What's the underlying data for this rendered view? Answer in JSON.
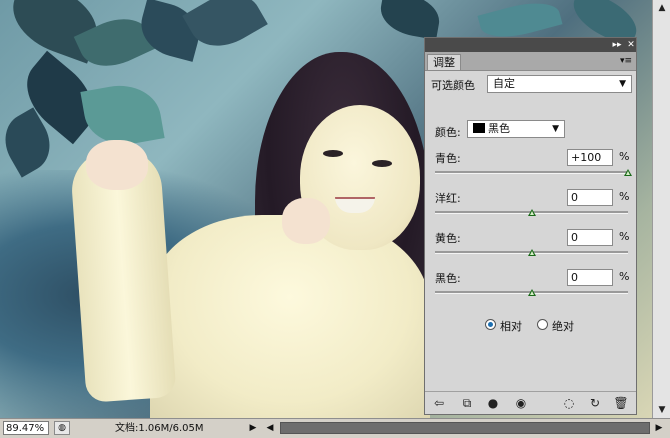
{
  "panel": {
    "tab_label": "调整",
    "collapse_icon": "double-chevron-right-icon",
    "close_icon": "close-icon",
    "menu_icon": "panel-menu-icon",
    "title_label": "可选颜色",
    "preset_value": "自定",
    "colors_label": "颜色:",
    "colors_value": "黑色",
    "sliders": [
      {
        "label": "青色:",
        "value": "+100",
        "unit": "%",
        "position": 1.0
      },
      {
        "label": "洋红:",
        "value": "0",
        "unit": "%",
        "position": 0.5
      },
      {
        "label": "黄色:",
        "value": "0",
        "unit": "%",
        "position": 0.5
      },
      {
        "label": "黑色:",
        "value": "0",
        "unit": "%",
        "position": 0.5
      }
    ],
    "method": {
      "relative_label": "相对",
      "absolute_label": "绝对",
      "selected": "relative"
    },
    "toolbar_icons": [
      "back-arrow-icon",
      "clip-layer-icon",
      "visibility-eye-icon",
      "toggle-eye-icon",
      "view-previous-icon",
      "reset-icon",
      "trash-icon"
    ]
  },
  "status_bar": {
    "zoom": "89.47%",
    "doc_info": "文档:1.06M/6.05M"
  }
}
